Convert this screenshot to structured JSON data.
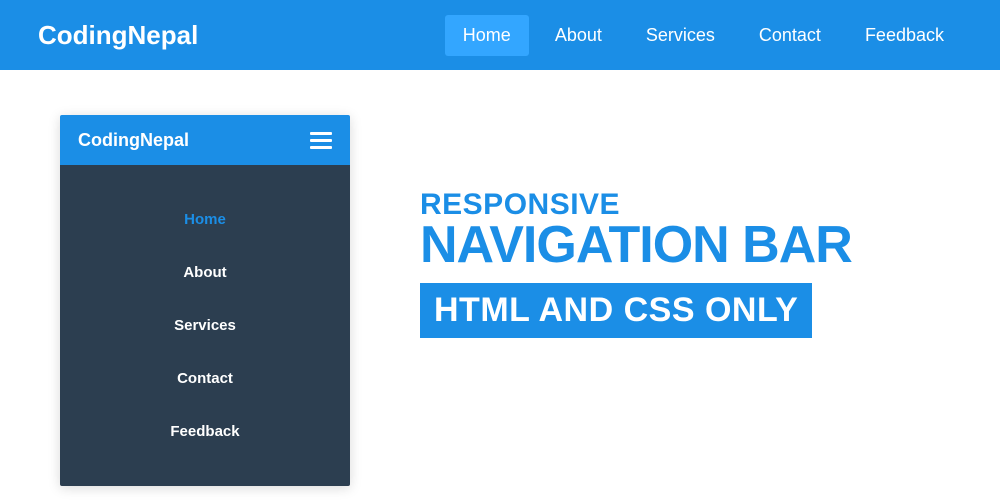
{
  "brand": "CodingNepal",
  "nav": {
    "items": [
      {
        "label": "Home",
        "active": true
      },
      {
        "label": "About",
        "active": false
      },
      {
        "label": "Services",
        "active": false
      },
      {
        "label": "Contact",
        "active": false
      },
      {
        "label": "Feedback",
        "active": false
      }
    ]
  },
  "mobile": {
    "brand": "CodingNepal",
    "items": [
      {
        "label": "Home",
        "active": true
      },
      {
        "label": "About",
        "active": false
      },
      {
        "label": "Services",
        "active": false
      },
      {
        "label": "Contact",
        "active": false
      },
      {
        "label": "Feedback",
        "active": false
      }
    ]
  },
  "headline": {
    "line1": "RESPONSIVE",
    "line2": "NAVIGATION BAR",
    "badge": "HTML AND CSS ONLY"
  },
  "colors": {
    "primary": "#1b8ee6",
    "active": "#33a6ff",
    "dark": "#2c3e50"
  }
}
